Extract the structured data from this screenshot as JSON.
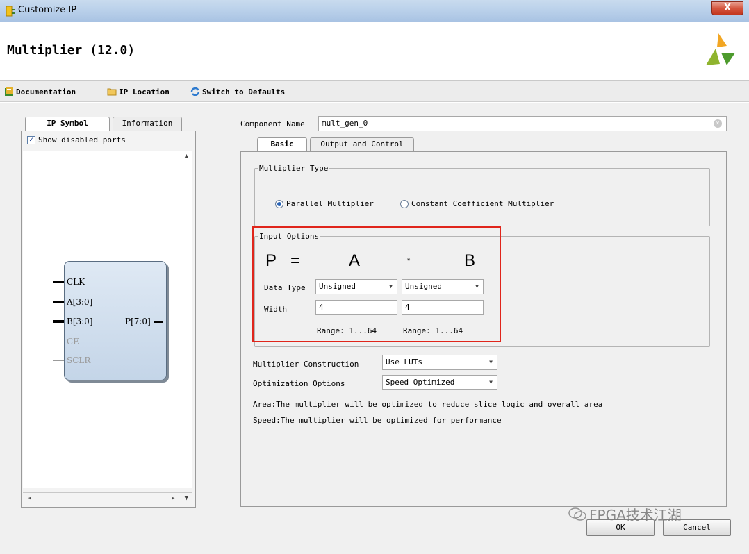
{
  "window": {
    "title": "Customize IP",
    "close_glyph": "X"
  },
  "header": {
    "core_name": "Multiplier (12.0)",
    "logo_icon": "xilinx-logo"
  },
  "toolbar": {
    "documentation": "Documentation",
    "ip_location": "IP Location",
    "switch_defaults": "Switch to Defaults"
  },
  "left": {
    "tabs": [
      "IP Symbol",
      "Information"
    ],
    "active_tab": "IP Symbol",
    "show_disabled_ports": "Show disabled ports",
    "show_disabled_checked": true,
    "scroll_up": "▲",
    "scroll_down": "▼",
    "scroll_left": "◄",
    "scroll_right": "►",
    "ports_in": [
      "CLK",
      "A[3:0]",
      "B[3:0]",
      "CE",
      "SCLR"
    ],
    "port_out": "P[7:0]"
  },
  "component": {
    "label": "Component Name",
    "value": "mult_gen_0",
    "clear_glyph": "×"
  },
  "config_tabs": [
    "Basic",
    "Output and Control"
  ],
  "active_config_tab": "Basic",
  "multiplier_type": {
    "legend": "Multiplier Type",
    "options": [
      "Parallel Multiplier",
      "Constant Coefficient Multiplier"
    ],
    "selected": "Parallel Multiplier"
  },
  "input_options": {
    "legend": "Input Options",
    "equation": {
      "p": "P",
      "equals": "=",
      "a": "A",
      "times": "*",
      "b": "B"
    },
    "data_type_label": "Data Type",
    "a_data_type": "Unsigned",
    "b_data_type": "Unsigned",
    "width_label": "Width",
    "a_width": "4",
    "b_width": "4",
    "a_range": "Range: 1...64",
    "b_range": "Range: 1...64",
    "dropdown_arrow": "▼"
  },
  "construction": {
    "label": "Multiplier Construction",
    "value": "Use LUTs"
  },
  "optimization": {
    "label": "Optimization Options",
    "value": "Speed Optimized",
    "area_note": "Area:The multiplier will be optimized to reduce slice logic and overall area",
    "speed_note": "Speed:The multiplier will be optimized for performance"
  },
  "buttons": {
    "ok": "OK",
    "cancel": "Cancel"
  },
  "watermark": {
    "text": "FPGA技术江湖",
    "icon": "wechat-icon"
  },
  "colors": {
    "highlight_border": "#e0251b",
    "radio_selected": "#2a64b6"
  }
}
